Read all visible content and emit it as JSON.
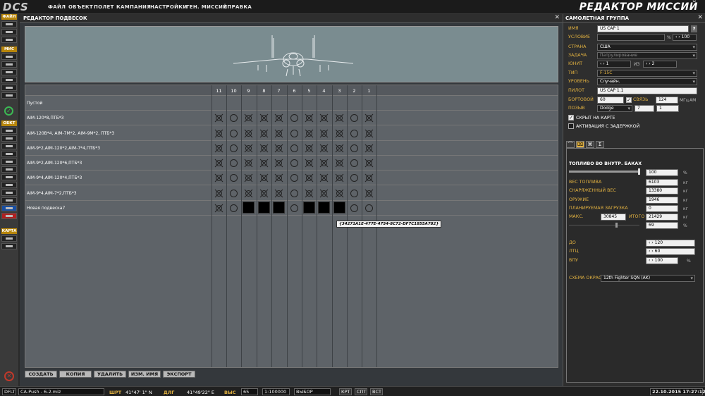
{
  "app": {
    "logo": "DCS",
    "title": "РЕДАКТОР МИССИЙ"
  },
  "menu": [
    "ФАЙЛ",
    "ОБЪЕКТ",
    "ПОЛЕТ",
    "КАМПАНИЯ",
    "НАСТРОЙКИ",
    "ГЕН. МИССИЙ",
    "СПРАВКА"
  ],
  "toolbar": {
    "sections": [
      "ФАЙЛ",
      "МИС",
      "ОБКТ",
      "КАРТА"
    ]
  },
  "payload": {
    "title": "РЕДАКТОР ПОДВЕСОК",
    "stations": [
      "11",
      "10",
      "9",
      "8",
      "7",
      "6",
      "5",
      "4",
      "3",
      "2",
      "1"
    ],
    "rows": [
      {
        "label": "Пустой",
        "cells": [
          "",
          "",
          "",
          "",
          "",
          "",
          "",
          "",
          "",
          "",
          ""
        ]
      },
      {
        "label": "AIM-120*8,ПТБ*3",
        "cells": [
          "x",
          "o",
          "x",
          "x",
          "x",
          "o",
          "x",
          "x",
          "x",
          "o",
          "x"
        ]
      },
      {
        "label": "AIM-120B*4, AIM-7M*2, AIM-9M*2, ПТБ*3",
        "cells": [
          "x",
          "o",
          "x",
          "x",
          "x",
          "o",
          "x",
          "x",
          "x",
          "o",
          "x"
        ]
      },
      {
        "label": "AIM-9*2,AIM-120*2,AIM-7*4,ПТБ*3",
        "cells": [
          "x",
          "o",
          "x",
          "x",
          "x",
          "o",
          "x",
          "x",
          "x",
          "o",
          "x"
        ]
      },
      {
        "label": "AIM-9*2,AIM-120*6,ПТБ*3",
        "cells": [
          "x",
          "o",
          "x",
          "x",
          "x",
          "o",
          "x",
          "x",
          "x",
          "o",
          "x"
        ]
      },
      {
        "label": "AIM-9*4,AIM-120*4,ПТБ*3",
        "cells": [
          "x",
          "o",
          "x",
          "x",
          "x",
          "o",
          "x",
          "x",
          "x",
          "o",
          "x"
        ]
      },
      {
        "label": "AIM-9*4,AIM-7*2,ПТБ*3",
        "cells": [
          "x",
          "o",
          "x",
          "x",
          "x",
          "o",
          "x",
          "x",
          "x",
          "o",
          "x"
        ]
      },
      {
        "label": "Новая подвеска7",
        "cells": [
          "x",
          "o",
          "b",
          "b",
          "b",
          "o",
          "b",
          "b",
          "b",
          "o",
          "o"
        ]
      }
    ],
    "tooltip": "{34271A1E-477E-4754-8C72-DF7C1855A782}",
    "buttons": [
      "СОЗДАТЬ",
      "КОПИЯ",
      "УДАЛИТЬ",
      "ИЗМ. ИМЯ",
      "ЭКСПОРТ"
    ]
  },
  "group": {
    "title": "САМОЛЕТНАЯ ГРУППА",
    "name_label": "ИМЯ",
    "name": "US CAP 1",
    "help": "?",
    "condition_label": "УСЛОВИЕ",
    "condition_pct": "%",
    "condition_val": "100",
    "country_label": "СТРАНА",
    "country": "США",
    "task_label": "ЗАДАЧА",
    "task": "Патрулирование",
    "unit_label": "ЮНИТ",
    "unit_num": "1",
    "unit_of": "ИЗ",
    "unit_total": "2",
    "type_label": "ТИП",
    "type": "F-15C",
    "skill_label": "УРОВЕНЬ",
    "skill": "Случайн.",
    "pilot_label": "ПИЛОТ",
    "pilot": "US CAP 1.1",
    "board_label": "БОРТОВОЙ",
    "board": "60",
    "radio_label": "СВЯЗЬ",
    "freq": "124",
    "freq_unit": "МГц",
    "band": "AM",
    "callsign_label": "ПОЗЫВ",
    "callsign": "Dodge",
    "cs1": "7",
    "cs2": "1",
    "hidden_label": "СКРЫТ НА КАРТЕ",
    "late_label": "АКТИВАЦИЯ С ЗАДЕРЖКОЙ",
    "tabs": [
      "⌒",
      "⌧",
      "⌘",
      "Σ"
    ]
  },
  "fuel": {
    "title": "ТОПЛИВО ВО ВНУТР. БАКАХ",
    "pct": "100",
    "pct_unit": "%",
    "fuel_fraction": 1.0,
    "rows": [
      {
        "label": "ВЕС ТОПЛИВА",
        "value": "6103",
        "unit": "кг"
      },
      {
        "label": "СНАРЯЖЕННЫЙ ВЕС",
        "value": "13380",
        "unit": "кг"
      },
      {
        "label": "ОРУЖИЕ",
        "value": "1946",
        "unit": "кг"
      },
      {
        "label": "ПЛАНИРУЕМАЯ ЗАГРУЗКА",
        "value": "0",
        "unit": "кг"
      }
    ],
    "max_label": "МАКС.",
    "max": "30845",
    "total_label": "ИТОГО",
    "total": "21429",
    "total_unit": "кг",
    "load_pct": "69",
    "load_unit": "%",
    "do_label": "ДО",
    "do": "120",
    "ltc_label": "ЛТЦ",
    "ltc": "60",
    "vpu_label": "ВПУ",
    "vpu": "100",
    "vpu_unit": "%",
    "livery_label": "СХЕМА ОКРАС",
    "livery": "12th Fighter SQN (AK)"
  },
  "status": {
    "mode": "DFLT",
    "file": "CA-Push - 6-2.miz",
    "lat_label": "ШРТ",
    "lat": "41°47' 1\" N",
    "lon_label": "ДЛГ",
    "lon": "41°49'22\" E",
    "alt_label": "ВЫС",
    "alt": "65",
    "scale": "1:100000",
    "select": "ВЫБОР",
    "b1": "КРТ",
    "b2": "СПТ",
    "b3": "ВСТ",
    "datetime": "22.10.2015 17:27:12"
  }
}
